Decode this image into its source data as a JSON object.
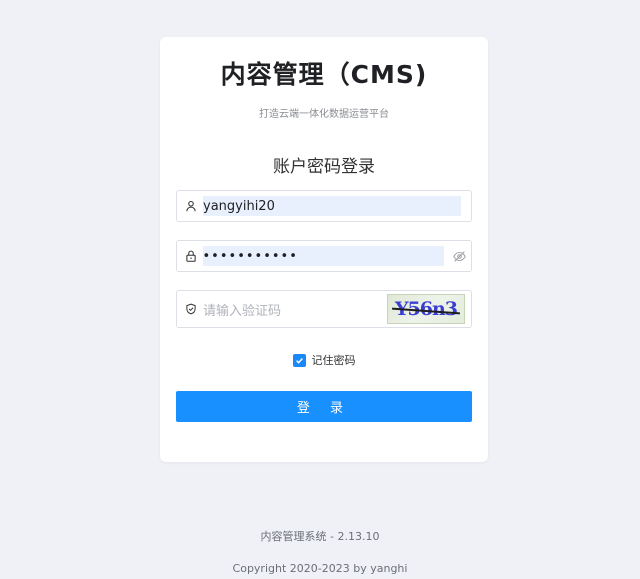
{
  "login": {
    "title": "内容管理（CMS)",
    "subtitle": "打造云端一体化数据运营平台",
    "heading": "账户密码登录",
    "username_value": "yangyihi20",
    "password_value": "•••••••••••",
    "captcha_placeholder": "请输入验证码",
    "captcha_text": "Y56n3",
    "remember_label": "记住密码",
    "remember_checked": true,
    "submit_label": "登 录"
  },
  "icons": {
    "username": "user-icon",
    "password": "lock-icon",
    "password_toggle": "eye-off-icon",
    "captcha": "shield-icon",
    "checkbox": "checkmark-icon"
  },
  "colors": {
    "background": "#eff1f6",
    "primary": "#1890ff",
    "autofill": "#e8f0fe",
    "captcha_text": "#3b3fd1"
  },
  "footer": {
    "version": "内容管理系统 - 2.13.10",
    "copyright": "Copyright 2020-2023 by yanghi"
  }
}
